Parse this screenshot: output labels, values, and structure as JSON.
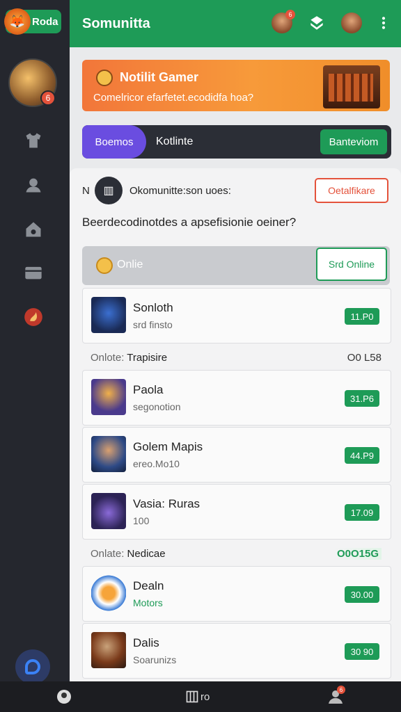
{
  "brand": {
    "label": "Roda"
  },
  "header": {
    "title": "Somunitta",
    "notif_badge": "6"
  },
  "sidebar": {
    "avatar_badge": "6"
  },
  "notification": {
    "title": "Notilit Gamer",
    "message": "Comelricor efarfetet.ecodidfa hoa?"
  },
  "tabs": {
    "active": "Boemos",
    "second": "Kotlinte",
    "action": "Banteviom"
  },
  "community": {
    "prefix": "N",
    "heading": "Okomunitte:son uoes:",
    "action": "Oetalfikare",
    "question": "Beerdecodinotdes a apsefisionie oeiner?"
  },
  "filter": {
    "label": "Onlie",
    "action": "Srd Online"
  },
  "list": {
    "items": [
      {
        "name": "Sonloth",
        "sub": "srd finsto",
        "price": "11.P0"
      }
    ],
    "section1": {
      "label": "Onlote:",
      "title": "Trapisire",
      "count": "O0 L58"
    },
    "items2": [
      {
        "name": "Paola",
        "sub": "segonotion",
        "price": "31.P6"
      },
      {
        "name": "Golem Mapis",
        "sub": "ereo.Mo10",
        "price": "44.P9"
      },
      {
        "name": "Vasia: Ruras",
        "sub": "100",
        "price": "17.09"
      }
    ],
    "section2": {
      "label": "Onlate:",
      "title": "Nedicae",
      "count": "O0O15G"
    },
    "items3": [
      {
        "name": "Dealn",
        "sub": "Motors",
        "price": "30.00"
      },
      {
        "name": "Dalis",
        "sub": "Soarunizs",
        "price": "30 90"
      }
    ]
  },
  "bottomnav": {
    "center_label": "ro",
    "badge": "6"
  },
  "colors": {
    "accent": "#1e9b57",
    "danger": "#e4523b",
    "purple": "#6a4de0",
    "orange": "#f2763a"
  }
}
